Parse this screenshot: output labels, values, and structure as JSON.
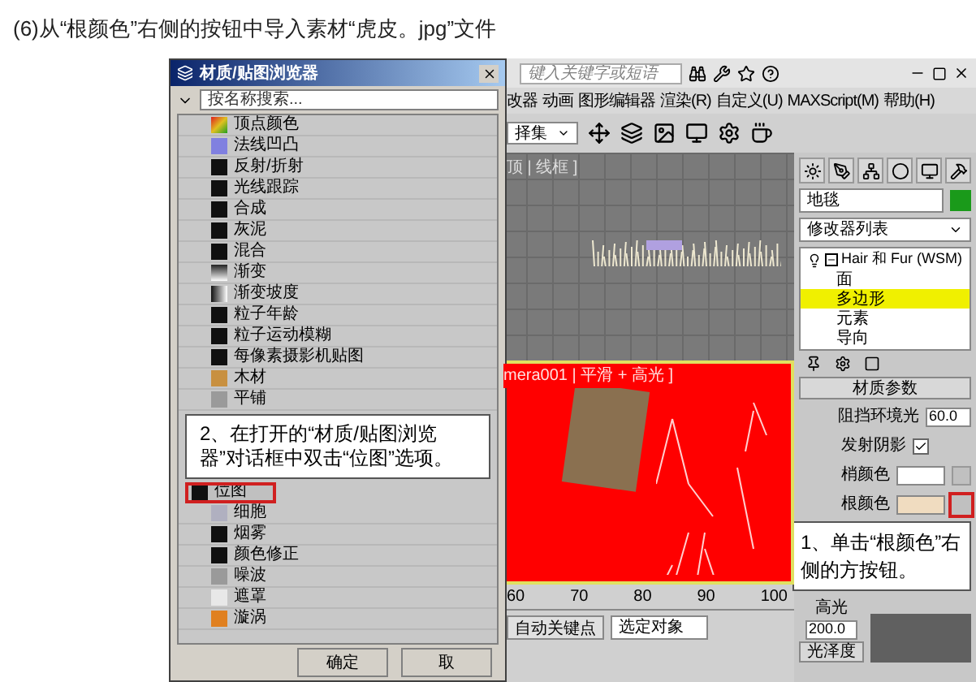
{
  "caption": "(6)从“根颜色”右侧的按钮中导入素材“虎皮。jpg”文件",
  "browser": {
    "title": "材质/贴图浏览器",
    "search_placeholder": "按名称搜索...",
    "items_above": [
      {
        "label": "顶点颜色",
        "kind": "rainbow",
        "selected": false
      },
      {
        "label": "法线凹凸",
        "kind": "violet",
        "selected": false
      },
      {
        "label": "反射/折射",
        "kind": "dark",
        "selected": false
      },
      {
        "label": "光线跟踪",
        "kind": "dark",
        "selected": false
      },
      {
        "label": "合成",
        "kind": "dark",
        "selected": false
      },
      {
        "label": "灰泥",
        "kind": "dark",
        "selected": false
      },
      {
        "label": "混合",
        "kind": "dark",
        "selected": false
      },
      {
        "label": "渐变",
        "kind": "gradient",
        "selected": false
      },
      {
        "label": "渐变坡度",
        "kind": "ramp",
        "selected": false
      },
      {
        "label": "粒子年龄",
        "kind": "dark",
        "selected": false
      },
      {
        "label": "粒子运动模糊",
        "kind": "dark",
        "selected": false
      },
      {
        "label": "每像素摄影机贴图",
        "kind": "dark",
        "selected": false
      },
      {
        "label": "木材",
        "kind": "wood",
        "selected": false
      },
      {
        "label": "平铺",
        "kind": "gray",
        "selected": false
      }
    ],
    "items_below": [
      {
        "label": "位图",
        "kind": "dark",
        "selected": true
      },
      {
        "label": "细胞",
        "kind": "cells",
        "selected": false
      },
      {
        "label": "烟雾",
        "kind": "dark",
        "selected": false
      },
      {
        "label": "颜色修正",
        "kind": "dark",
        "selected": false
      },
      {
        "label": "噪波",
        "kind": "gray",
        "selected": false
      },
      {
        "label": "遮罩",
        "kind": "light",
        "selected": false
      },
      {
        "label": "漩涡",
        "kind": "swirl",
        "selected": false
      }
    ],
    "callout": "2、在打开的“材质/贴图浏览器”对话框中双击“位图”选项。",
    "buttons": [
      "确定",
      "取"
    ]
  },
  "max": {
    "search_placeholder": "键入关键字或短语",
    "menu": [
      "改器",
      "动画",
      "图形编辑器",
      "渲染(R)",
      "自定义(U)",
      "MAXScript(M)",
      "帮助(H)"
    ],
    "selection_set": "择集",
    "top_viewport_label": "顶 | 线框 ]",
    "camera_viewport_label": "mera001 | 平滑 + 高光 ]",
    "timeline_ticks": [
      "60",
      "70",
      "80",
      "90",
      "100"
    ],
    "auto_key": "自动关键点",
    "selection_dropdown": "选定对象",
    "command": {
      "object_name": "地毯",
      "modifier_list": "修改器列表",
      "tree": [
        {
          "label": "Hair 和 Fur (WSM)",
          "expanded": true,
          "children": [
            {
              "label": "面",
              "selected": false
            },
            {
              "label": "多边形",
              "selected": true
            },
            {
              "label": "元素",
              "selected": false
            },
            {
              "label": "导向",
              "selected": false
            }
          ]
        }
      ],
      "rollout": "材质参数",
      "params": [
        {
          "kind": "spinner",
          "label": "阻挡环境光",
          "value": "60.0"
        },
        {
          "kind": "checkbox",
          "label": "发射阴影",
          "checked": true
        },
        {
          "kind": "color",
          "label": "梢颜色",
          "color": "#ffffff",
          "marked": false
        },
        {
          "kind": "color",
          "label": "根颜色",
          "color": "#f0dcc0",
          "marked": true
        }
      ],
      "callout": "1、单击“根颜色”右侧的方按钮。",
      "spec_label": "高光",
      "spec_value": "200.0",
      "gloss_button": "光泽度"
    }
  }
}
